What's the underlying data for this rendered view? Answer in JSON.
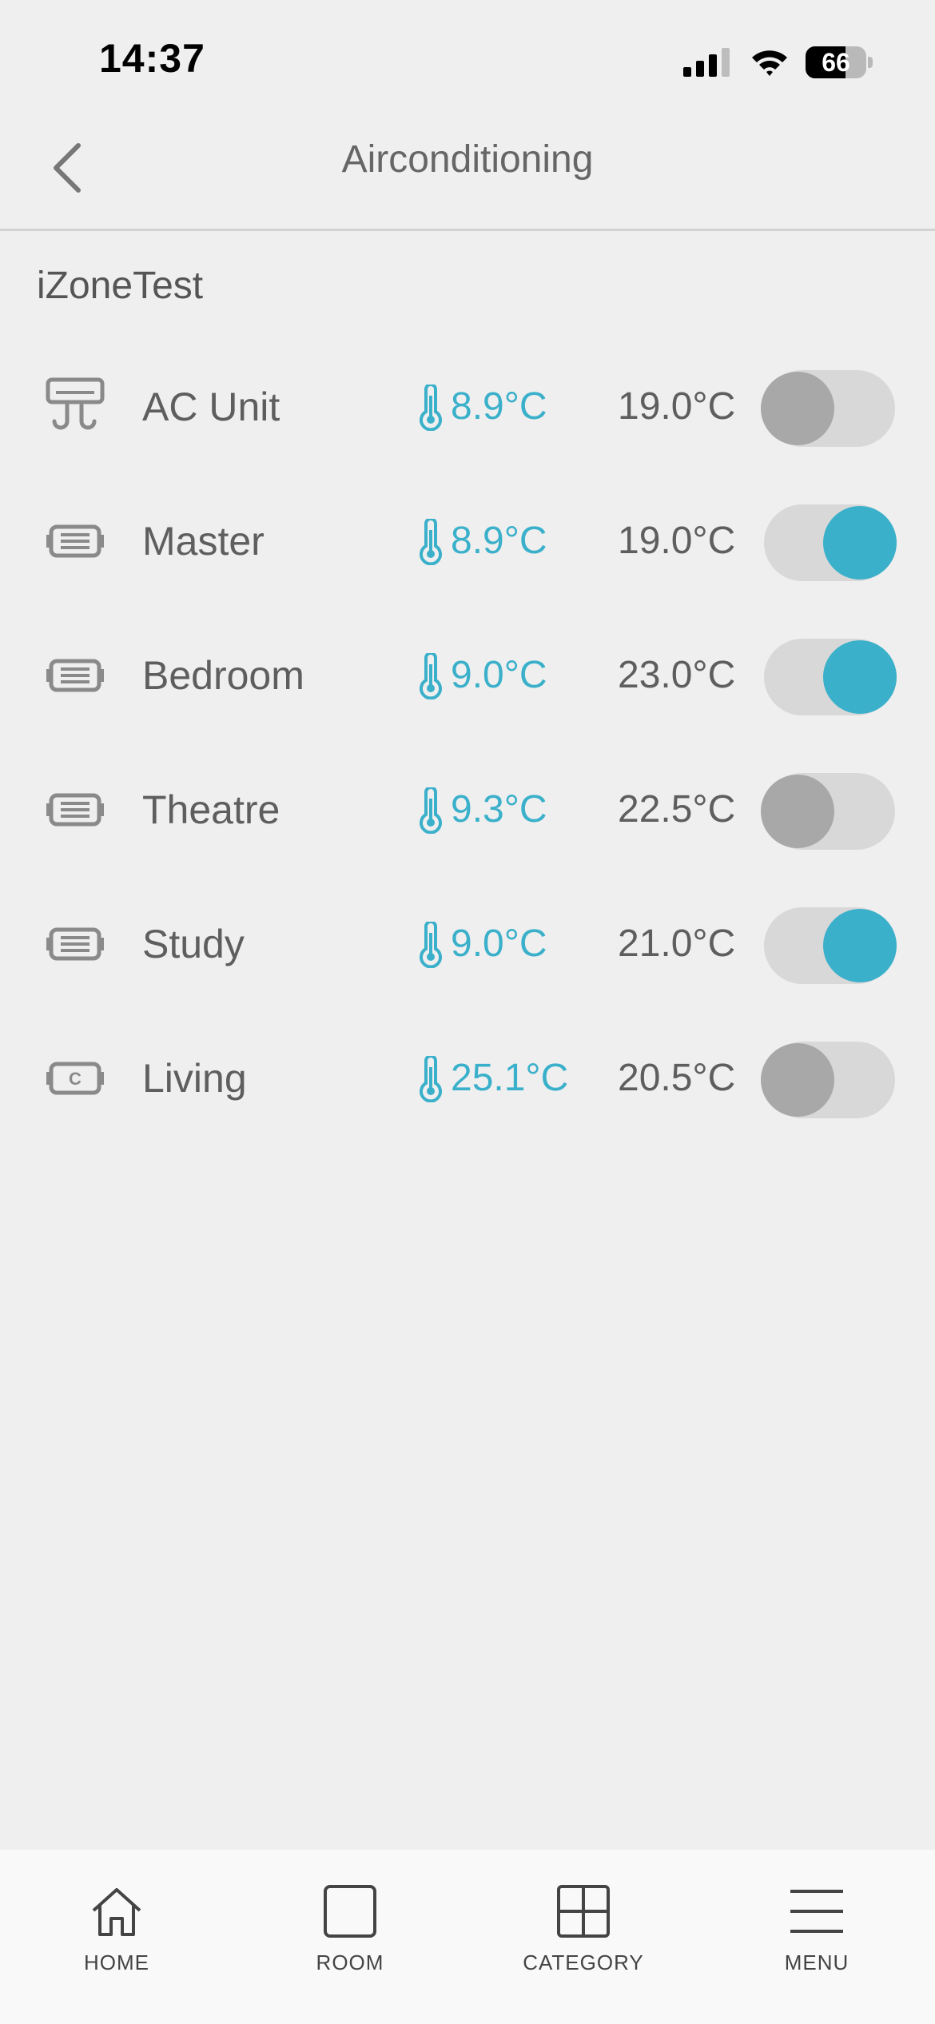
{
  "status_bar": {
    "time": "14:37",
    "battery_level": 66,
    "battery_text": "66"
  },
  "header": {
    "title": "Airconditioning",
    "back_icon": "chevron-left-icon"
  },
  "group": {
    "title": "iZoneTest"
  },
  "colors": {
    "accent": "#3bb0ca",
    "text": "#5e5e5e",
    "toggle_off_knob": "#a8a8a8",
    "toggle_track": "#d8d8d8",
    "background": "#efefef"
  },
  "zones": [
    {
      "name": "AC Unit",
      "icon": "ac-unit-icon",
      "current_temp": "8.9°C",
      "setpoint": "19.0°C",
      "on": false
    },
    {
      "name": "Master",
      "icon": "zone-vent-icon",
      "current_temp": "8.9°C",
      "setpoint": "19.0°C",
      "on": true
    },
    {
      "name": "Bedroom",
      "icon": "zone-vent-icon",
      "current_temp": "9.0°C",
      "setpoint": "23.0°C",
      "on": true
    },
    {
      "name": "Theatre",
      "icon": "zone-vent-icon",
      "current_temp": "9.3°C",
      "setpoint": "22.5°C",
      "on": false
    },
    {
      "name": "Study",
      "icon": "zone-vent-icon",
      "current_temp": "9.0°C",
      "setpoint": "21.0°C",
      "on": true
    },
    {
      "name": "Living",
      "icon": "zone-constant-icon",
      "current_temp": "25.1°C",
      "setpoint": "20.5°C",
      "on": false
    }
  ],
  "tabs": [
    {
      "label": "HOME",
      "icon": "home-icon"
    },
    {
      "label": "ROOM",
      "icon": "room-icon"
    },
    {
      "label": "CATEGORY",
      "icon": "category-icon"
    },
    {
      "label": "MENU",
      "icon": "menu-icon"
    }
  ]
}
